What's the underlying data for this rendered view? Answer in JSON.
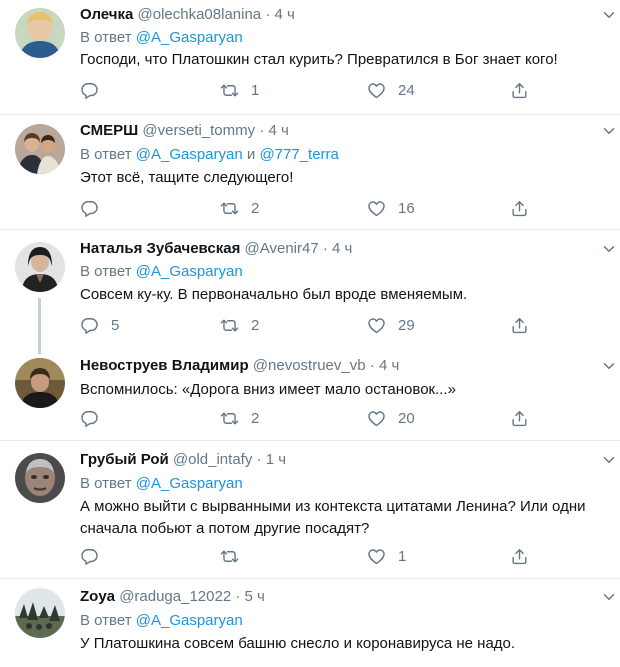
{
  "tweets": [
    {
      "name": "Олечка",
      "handle": "@olechka08lanina",
      "time": "4 ч",
      "reply_prefix": "В ответ",
      "mentions": [
        "@A_Gasparyan"
      ],
      "joiner": "",
      "text": "Господи, что Платошкин стал курить? Превратился в Бог знает кого!",
      "replies": "",
      "retweets": "1",
      "likes": "24"
    },
    {
      "name": "СМЕРШ",
      "handle": "@verseti_tommy",
      "time": "4 ч",
      "reply_prefix": "В ответ",
      "mentions": [
        "@A_Gasparyan",
        "@777_terra"
      ],
      "joiner": "и",
      "text": "Этот всё, тащите следующего!",
      "replies": "",
      "retweets": "2",
      "likes": "16"
    },
    {
      "name": "Наталья Зубачевская",
      "handle": "@Avenir47",
      "time": "4 ч",
      "reply_prefix": "В ответ",
      "mentions": [
        "@A_Gasparyan"
      ],
      "joiner": "",
      "text": "Совсем ку-ку. В первоначально был вроде вменяемым.",
      "replies": "5",
      "retweets": "2",
      "likes": "29"
    },
    {
      "name": "Невоструев Владимир",
      "handle": "@nevostruev_vb",
      "time": "4 ч",
      "reply_prefix": "",
      "mentions": [],
      "joiner": "",
      "text": "Вспомнилось: «Дорога вниз имеет мало остановок...»",
      "replies": "",
      "retweets": "2",
      "likes": "20"
    },
    {
      "name": "Грубый Рой",
      "handle": "@old_intafy",
      "time": "1 ч",
      "reply_prefix": "В ответ",
      "mentions": [
        "@A_Gasparyan"
      ],
      "joiner": "",
      "text": "А можно выйти с вырванными из контекста цитатами Ленина? Или одни сначала побьют а потом другие посадят?",
      "replies": "",
      "retweets": "",
      "likes": "1"
    },
    {
      "name": "Zoya",
      "handle": "@raduga_12022",
      "time": "5 ч",
      "reply_prefix": "В ответ",
      "mentions": [
        "@A_Gasparyan"
      ],
      "joiner": "",
      "text": "У Платошкина совсем башню снесло и коронавируса не надо.",
      "replies": "",
      "retweets": "",
      "likes": ""
    }
  ],
  "separator": "·",
  "icons": {
    "reply": "reply-icon",
    "retweet": "retweet-icon",
    "like": "heart-icon",
    "share": "share-icon",
    "menu": "chevron-down-icon"
  },
  "colors": {
    "accent": "#1b95e0",
    "muted": "#657786",
    "text": "#0f1419",
    "border": "#e6ecf0"
  }
}
